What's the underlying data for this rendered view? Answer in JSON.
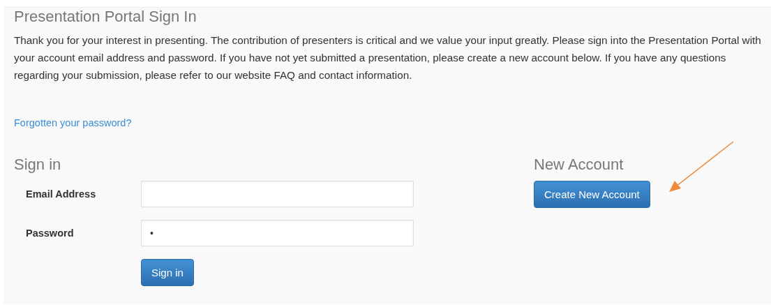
{
  "title": "Presentation Portal Sign In",
  "intro": "Thank you for your interest in presenting. The contribution of presenters is critical and we value your input greatly. Please sign into the Presentation Portal with your account email address and password. If you have not yet submitted a presentation, please create a new account below. If you have any questions regarding your submission, please refer to our website FAQ and contact information.",
  "forgot_link": "Forgotten your password?",
  "sign_in": {
    "heading": "Sign in",
    "fields": [
      {
        "label": "Email Address"
      },
      {
        "label": "Password",
        "value": "•"
      }
    ],
    "button": "Sign in"
  },
  "new_account": {
    "heading": "New Account",
    "button": "Create New Account"
  },
  "annotation": {
    "kind": "arrow",
    "color": "#ee8a3a"
  }
}
